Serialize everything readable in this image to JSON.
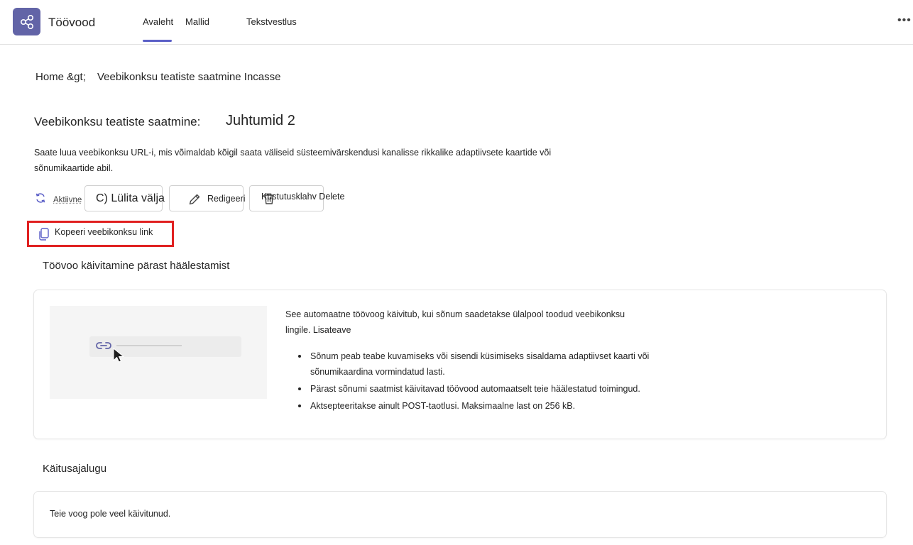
{
  "app": {
    "title": "Töövood",
    "icon": "workflow-icon",
    "accent_color": "#6264a7"
  },
  "tabs": [
    {
      "label": "Avaleht",
      "active": true
    },
    {
      "label": "Mallid",
      "active": false
    },
    {
      "label": "Tekstvestlus",
      "active": false
    }
  ],
  "header": {
    "more_label": "•••"
  },
  "breadcrumb": {
    "home": "Home &gt;",
    "current": "Veebikonksu teatiste saatmine Incasse"
  },
  "page": {
    "title": "Veebikonksu teatiste saatmine:",
    "run_count": "Juhtumid 2",
    "description": "Saate luua veebikonksu URL-i, mis võimaldab kõigil saata väliseid süsteemivärskendusi kanalisse rikkalike adaptiivsete kaartide või sõnumikaartide abil."
  },
  "actions": {
    "status_label": "Aktiivne",
    "toggle_label": "C) Lülita välja",
    "edit_label": "Redigeeri",
    "delete_label": "Kustutusklahv Delete",
    "copy_link_label": "Kopeeri veebikonksu link"
  },
  "trigger_section": {
    "title": "Töövoo käivitamine pärast häälestamist",
    "intro": "See automaatne töövoog käivitub, kui sõnum saadetakse ülalpool toodud veebikonksu lingile. Lisateave",
    "bullets": [
      "Sõnum peab teabe kuvamiseks või sisendi küsimiseks sisaldama adaptiivset kaarti või sõnumikaardina vormindatud lasti.",
      "Pärast sõnumi saatmist käivitavad töövood automaatselt teie häälestatud toimingud.",
      "Aktsepteeritakse ainult POST-taotlusi. Maksimaalne last on 256 kB."
    ]
  },
  "history_section": {
    "title": "Käitusajalugu",
    "empty_text": "Teie voog pole veel käivitunud."
  }
}
